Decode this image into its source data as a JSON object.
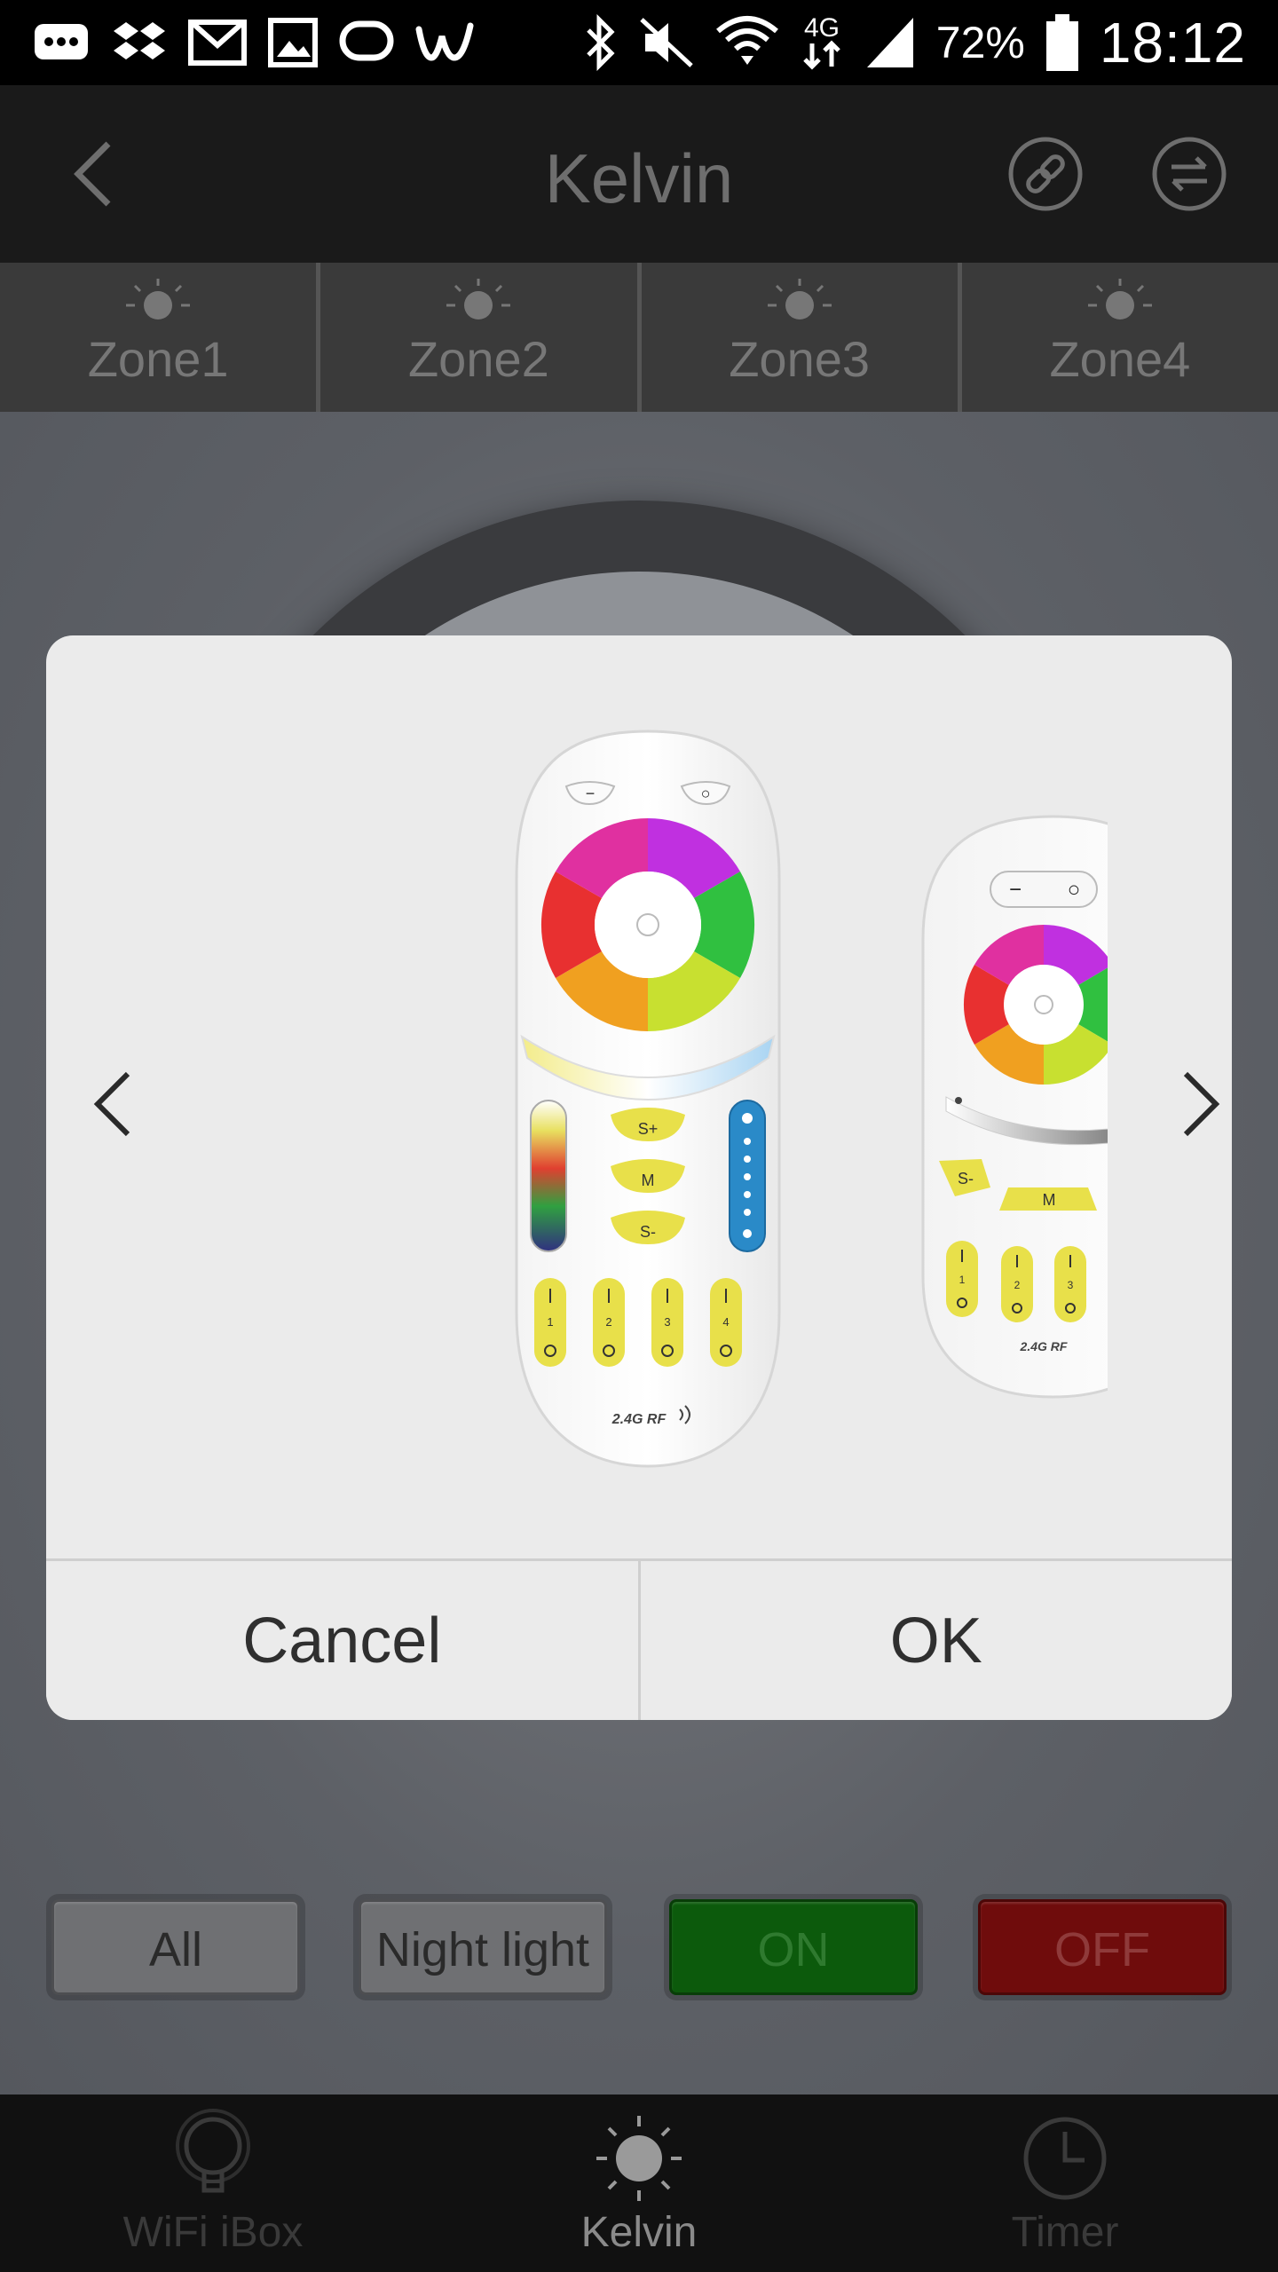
{
  "status_bar": {
    "battery_percent": "72%",
    "time": "18:12",
    "network": "4G",
    "icons": [
      "messages-icon",
      "dropbox-icon",
      "gmail-icon",
      "gallery-icon",
      "chat-icon",
      "w-app-icon",
      "bluetooth-icon",
      "mute-icon",
      "wifi-icon",
      "mobile-data-icon",
      "signal-icon",
      "battery-icon"
    ]
  },
  "app_bar": {
    "title": "Kelvin",
    "icons": [
      "back-icon",
      "link-icon",
      "swap-icon"
    ]
  },
  "zones": [
    {
      "label": "Zone1"
    },
    {
      "label": "Zone2"
    },
    {
      "label": "Zone3"
    },
    {
      "label": "Zone4"
    }
  ],
  "actions": {
    "all": "All",
    "night_light": "Night light",
    "on": "ON",
    "off": "OFF"
  },
  "colors": {
    "on_button": "#0c5a0c",
    "off_button": "#6f0c0c",
    "dialog_bg": "#ebebeb",
    "remote_zone_buttons": "#e8e04a",
    "remote_kelvin_slider": "#2a8ac8"
  },
  "dialog": {
    "cancel": "Cancel",
    "ok": "OK",
    "remote_main": {
      "top_buttons": [
        "−",
        "○"
      ],
      "middle_buttons": [
        "S+",
        "M",
        "S-"
      ],
      "zones": [
        "1",
        "2",
        "3",
        "4"
      ],
      "brand_text": "2.4G RF"
    },
    "remote_next": {
      "top_buttons": [
        "−",
        "○"
      ],
      "middle_buttons": [
        "S-",
        "M"
      ],
      "zones": [
        "1",
        "2",
        "3"
      ],
      "brand_text": "2.4G RF"
    }
  },
  "bottom_nav": [
    {
      "label": "WiFi iBox",
      "icon": "bulb-icon",
      "active": false
    },
    {
      "label": "Kelvin",
      "icon": "sun-icon",
      "active": true
    },
    {
      "label": "Timer",
      "icon": "clock-icon",
      "active": false
    }
  ]
}
